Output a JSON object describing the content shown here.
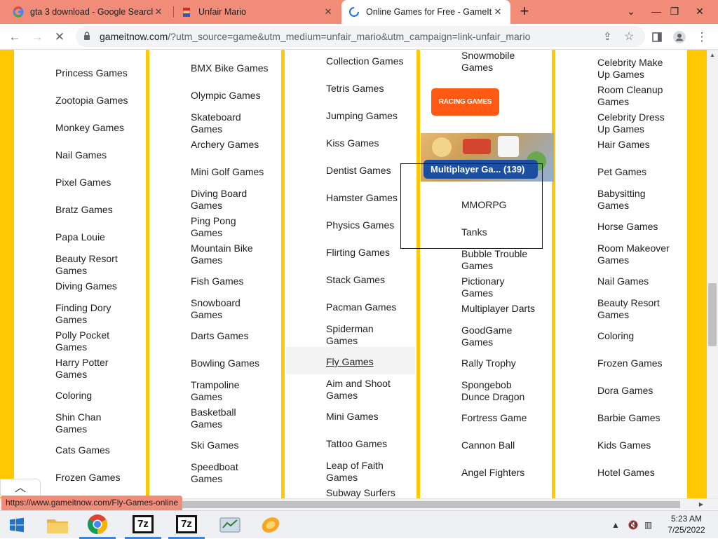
{
  "browser": {
    "tabs": [
      {
        "title": "gta 3 download - Google Search",
        "icon": "google-icon",
        "active": false
      },
      {
        "title": "Unfair Mario",
        "icon": "mario-icon",
        "active": false
      },
      {
        "title": "Online Games for Free - GameIt",
        "icon": "loading-icon",
        "active": true
      }
    ],
    "new_tab": "+",
    "url_host": "gameitnow.com",
    "url_path": "/?utm_source=game&utm_medium=unfair_mario&utm_campaign=link-unfair_mario",
    "status_url": "https://www.gameitnow.com/Fly-Games-online"
  },
  "columns": {
    "col1": [
      "Princess Games",
      "Zootopia Games",
      "Monkey Games",
      "Nail Games",
      "Pixel Games",
      "Bratz Games",
      "Papa Louie",
      "Beauty Resort\nGames",
      "Diving Games",
      "Finding Dory\nGames",
      "Polly Pocket\nGames",
      "Harry Potter\nGames",
      "Coloring",
      "Shin Chan\nGames",
      "Cats Games",
      "Frozen Games"
    ],
    "col2": [
      "BMX Bike Games",
      "Olympic Games",
      "Skateboard\nGames",
      "Archery Games",
      "Mini Golf Games",
      "Diving Board\nGames",
      "Ping Pong\nGames",
      "Mountain Bike\nGames",
      "Fish Games",
      "Snowboard\nGames",
      "Darts Games",
      "Bowling Games",
      "Trampoline\nGames",
      "Basketball\nGames",
      "Ski Games",
      "Speedboat\nGames"
    ],
    "col3": [
      "Collection Games",
      "Tetris Games",
      "Jumping Games",
      "Kiss Games",
      "Dentist Games",
      "Hamster Games",
      "Physics Games",
      "Flirting Games",
      "Stack Games",
      "Pacman Games",
      "Spiderman\nGames",
      "Fly Games",
      "Aim and Shoot\nGames",
      "Mini Games",
      "Tattoo Games",
      "Leap of Faith\nGames",
      "Subway Surfers"
    ],
    "col4_top": [
      "Snowmobile\nGames"
    ],
    "col4": [
      "MMORPG",
      "Tanks",
      "Bubble Trouble\nGames",
      "Pictionary\nGames",
      "Multiplayer Darts",
      "GoodGame\nGames",
      "Rally Trophy",
      "Spongebob\nDunce Dragon",
      "Fortress Game",
      "Cannon Ball",
      "Angel Fighters"
    ],
    "col5": [
      "Celebrity Make\nUp Games",
      "Room Cleanup\nGames",
      "Celebrity Dress\nUp Games",
      "Hair Games",
      "Pet Games",
      "Babysitting\nGames",
      "Horse Games",
      "Room Makeover\nGames",
      "Nail Games",
      "Beauty Resort\nGames",
      "Coloring",
      "Frozen Games",
      "Dora Games",
      "Barbie Games",
      "Kids Games",
      "Hotel Games"
    ]
  },
  "racing_button": "RACING GAMES",
  "multiplayer_badge": "Multiplayer Ga... (139)",
  "taskbar": {
    "time": "5:23 AM",
    "date": "7/25/2022",
    "zip_label": "7z"
  }
}
